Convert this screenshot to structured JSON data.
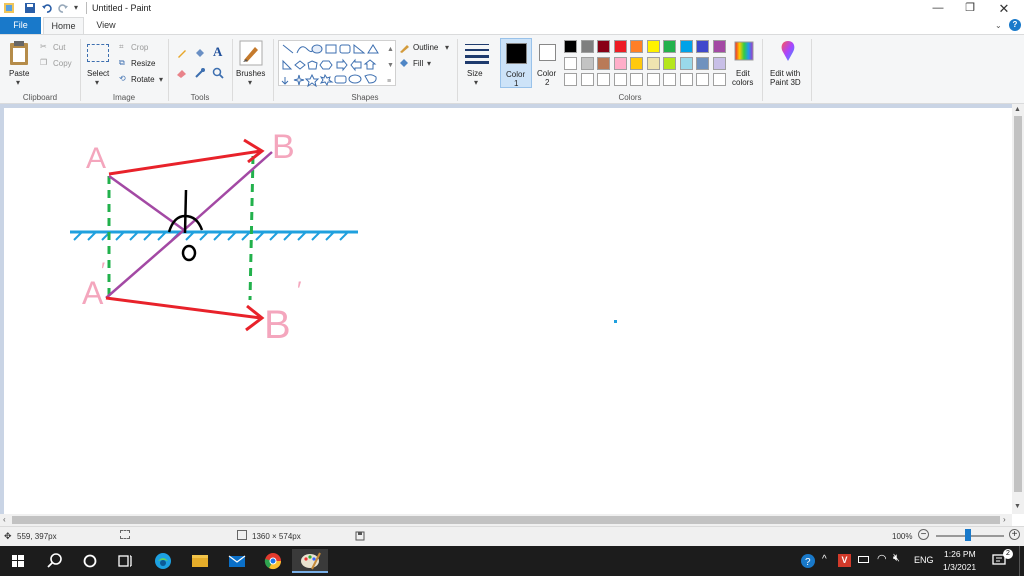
{
  "window": {
    "title": "Untitled - Paint"
  },
  "tabs": {
    "file": "File",
    "home": "Home",
    "view": "View"
  },
  "ribbon": {
    "clipboard": {
      "paste": "Paste",
      "cut": "Cut",
      "copy": "Copy",
      "label": "Clipboard"
    },
    "image": {
      "select": "Select",
      "crop": "Crop",
      "resize": "Resize",
      "rotate": "Rotate",
      "label": "Image"
    },
    "tools": {
      "label": "Tools"
    },
    "brushes": {
      "label": "Brushes"
    },
    "shapes": {
      "outline": "Outline",
      "fill": "Fill",
      "label": "Shapes"
    },
    "size": {
      "label": "Size"
    },
    "color1": {
      "line1": "Color",
      "line2": "1",
      "value": "#000000"
    },
    "color2": {
      "line1": "Color",
      "line2": "2",
      "value": "#ffffff"
    },
    "colors": {
      "label": "Colors",
      "palette_row1": [
        "#000000",
        "#7f7f7f",
        "#880015",
        "#ed1c24",
        "#ff7f27",
        "#fff200",
        "#22b14c",
        "#00a2e8",
        "#3f48cc",
        "#a349a4"
      ],
      "palette_row2": [
        "#ffffff",
        "#c3c3c3",
        "#b97a57",
        "#ffaec9",
        "#ffc90e",
        "#efe4b0",
        "#b5e61d",
        "#99d9ea",
        "#7092be",
        "#c8bfe7"
      ]
    },
    "edit_colors": {
      "line1": "Edit",
      "line2": "colors"
    },
    "paint3d": {
      "line1": "Edit with",
      "line2": "Paint 3D"
    }
  },
  "drawing": {
    "label_a": "A",
    "label_b": "B",
    "label_a_prime": "A",
    "label_b_prime": "B",
    "prime_mark": "′",
    "label_o": "O",
    "colors": {
      "ray": "#e8222a",
      "diagonal": "#a349a4",
      "projection": "#22b14c",
      "mirror": "#1fa0de",
      "labels": "#f4a6bd",
      "normal": "#000000"
    }
  },
  "status": {
    "cursor": "559, 397px",
    "canvas_size": "1360 × 574px",
    "zoom": "100%"
  },
  "taskbar": {
    "lang": "ENG",
    "time": "1:26 PM",
    "date": "1/3/2021"
  }
}
